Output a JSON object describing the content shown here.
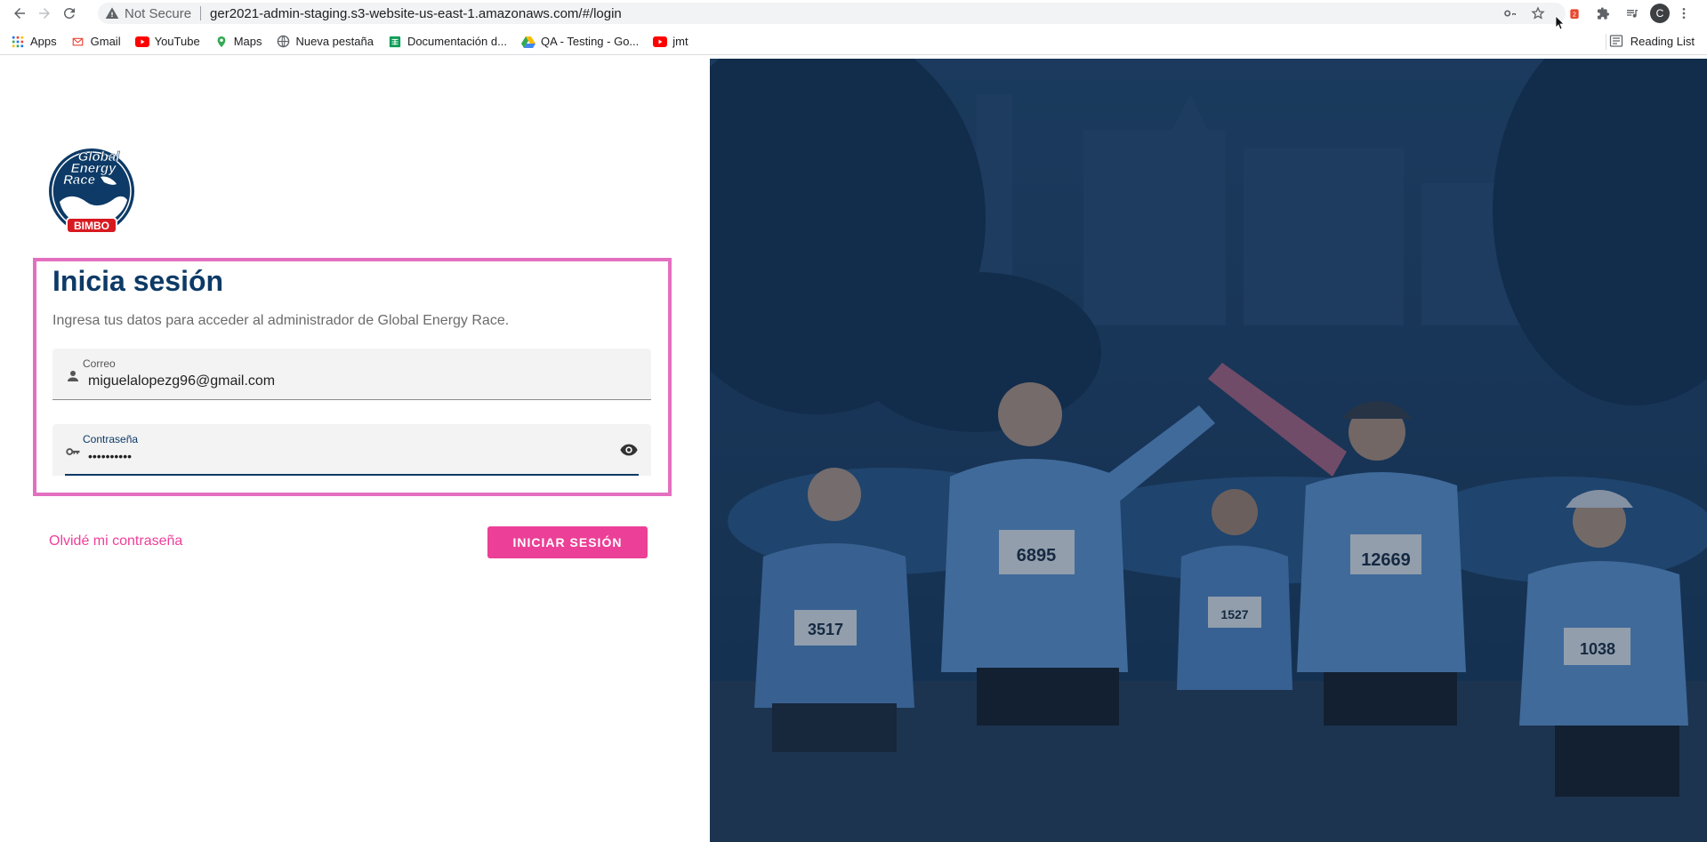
{
  "browser": {
    "security_label": "Not Secure",
    "url": "ger2021-admin-staging.s3-website-us-east-1.amazonaws.com/#/login",
    "profile_initial": "C",
    "bookmarks": [
      {
        "label": "Apps",
        "icon": "apps-grid-icon"
      },
      {
        "label": "Gmail",
        "icon": "gmail-icon"
      },
      {
        "label": "YouTube",
        "icon": "youtube-icon"
      },
      {
        "label": "Maps",
        "icon": "maps-pin-icon"
      },
      {
        "label": "Nueva pestaña",
        "icon": "globe-icon"
      },
      {
        "label": "Documentación d...",
        "icon": "sheets-icon"
      },
      {
        "label": "QA - Testing - Go...",
        "icon": "drive-icon"
      },
      {
        "label": "jmt",
        "icon": "youtube-icon"
      }
    ],
    "reading_list": "Reading List"
  },
  "login": {
    "logo_text": [
      "Global",
      "Energy",
      "Race"
    ],
    "logo_brand": "BIMBO",
    "title": "Inicia sesión",
    "subtitle": "Ingresa tus datos para acceder al administrador de Global Energy Race.",
    "email_label": "Correo",
    "email_value": "miguelalopezg96@gmail.com",
    "password_label": "Contraseña",
    "password_value": "••••••••••",
    "forgot_link": "Olvidé mi contraseña",
    "submit_label": "INICIAR SESIÓN"
  },
  "hero": {
    "bib_numbers": [
      "6895",
      "3517",
      "1527",
      "12669",
      "1038"
    ]
  },
  "colors": {
    "brand_navy": "#0d3a66",
    "brand_pink": "#ec3f97",
    "highlight_border": "#e36fc0",
    "hero_overlay": "#1c3a5e"
  }
}
